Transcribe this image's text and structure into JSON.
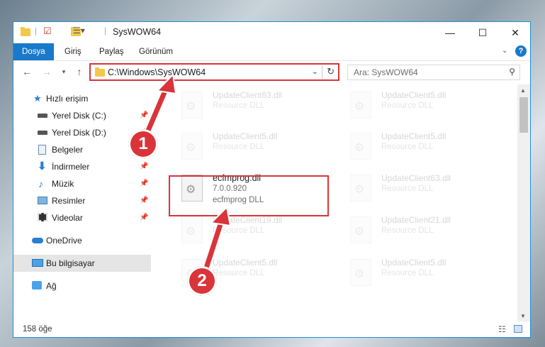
{
  "window": {
    "title": "SysWOW64"
  },
  "titlebar_controls": {
    "minimize": "—",
    "maximize": "☐",
    "close": "✕"
  },
  "ribbon": {
    "tabs": [
      "Dosya",
      "Giriş",
      "Paylaş",
      "Görünüm"
    ]
  },
  "address": {
    "path": "C:\\Windows\\SysWOW64"
  },
  "search": {
    "placeholder": "Ara: SysWOW64"
  },
  "nav": {
    "items": [
      {
        "label": "Hızlı erişim",
        "icon": "star-icon"
      },
      {
        "label": "Yerel Disk (C:)",
        "icon": "drive-icon",
        "pinned": true
      },
      {
        "label": "Yerel Disk (D:)",
        "icon": "drive-icon",
        "pinned": true
      },
      {
        "label": "Belgeler",
        "icon": "documents-icon",
        "pinned": true
      },
      {
        "label": "İndirmeler",
        "icon": "download-icon",
        "pinned": true
      },
      {
        "label": "Müzik",
        "icon": "music-icon",
        "pinned": true
      },
      {
        "label": "Resimler",
        "icon": "pictures-icon",
        "pinned": true
      },
      {
        "label": "Videolar",
        "icon": "video-icon",
        "pinned": true
      },
      {
        "label": "OneDrive",
        "icon": "cloud-icon"
      },
      {
        "label": "Bu bilgisayar",
        "icon": "computer-icon",
        "selected": true
      },
      {
        "label": "Ağ",
        "icon": "network-icon"
      }
    ]
  },
  "files": [
    {
      "name": "UpdateClient63.dll",
      "type": "Resource DLL"
    },
    {
      "name": "UpdateClient5.dll",
      "type": "Resource DLL"
    },
    {
      "name": "UpdateClient5.dll",
      "type": "Resource DLL"
    },
    {
      "name": "UpdateClient5.dll",
      "type": "Resource DLL"
    },
    {
      "name": "ecfmprog.dll",
      "version": "7.0.0.920",
      "type": "ecfmprog DLL"
    },
    {
      "name": "UpdateClient63.dll",
      "type": "Resource DLL"
    },
    {
      "name": "UpdateClient19.dll",
      "type": "Resource DLL"
    },
    {
      "name": "UpdateClient21.dll",
      "type": "Resource DLL"
    },
    {
      "name": "UpdateClient5.dll",
      "type": "Resource DLL"
    },
    {
      "name": "UpdateClient5.dll",
      "type": "Resource DLL"
    }
  ],
  "status": {
    "count": "158 öğe"
  },
  "callouts": [
    "1",
    "2"
  ],
  "colors": {
    "accent": "#1979ca",
    "highlight": "#d9343a"
  }
}
